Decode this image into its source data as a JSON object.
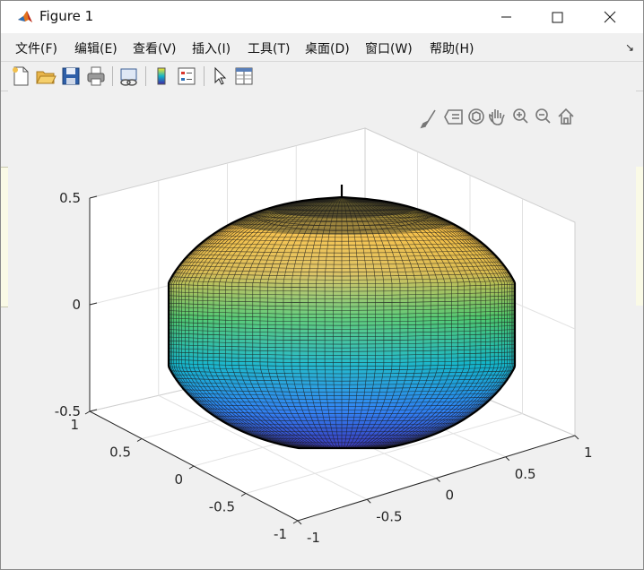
{
  "window": {
    "title": "Figure 1"
  },
  "menu": {
    "items": [
      "文件(F)",
      "编辑(E)",
      "查看(V)",
      "插入(I)",
      "工具(T)",
      "桌面(D)",
      "窗口(W)",
      "帮助(H)"
    ]
  },
  "toolbar": {
    "icons": [
      "new-figure-icon",
      "open-file-icon",
      "save-icon",
      "print-icon",
      "link-plot-icon",
      "insert-colorbar-icon",
      "insert-legend-icon",
      "edit-plot-icon",
      "property-inspector-icon"
    ]
  },
  "axes_toolbar": {
    "icons": [
      "brush-icon",
      "data-tips-icon",
      "rotate-3d-icon",
      "pan-icon",
      "zoom-in-icon",
      "zoom-out-icon",
      "home-icon"
    ]
  },
  "chart_data": {
    "type": "surface",
    "surface": "torus-like surface of revolution (dented top), colored by height with parula colormap",
    "z_ticks": [
      "0.5",
      "0",
      "-0.5"
    ],
    "x_ticks": [
      "1",
      "0.5",
      "0",
      "-0.5",
      "-1"
    ],
    "y_ticks": [
      "-1",
      "-0.5",
      "0",
      "0.5",
      "1"
    ],
    "zlim": [
      -0.5,
      0.5
    ],
    "xlim": [
      -1,
      1
    ],
    "ylim": [
      -1,
      1
    ],
    "colormap": "parula",
    "grid": true,
    "colors": [
      "#3e26a8",
      "#2f81f5",
      "#13b4c9",
      "#4ac66b",
      "#d9b94a",
      "#fbbe3a",
      "#f9e725"
    ]
  }
}
